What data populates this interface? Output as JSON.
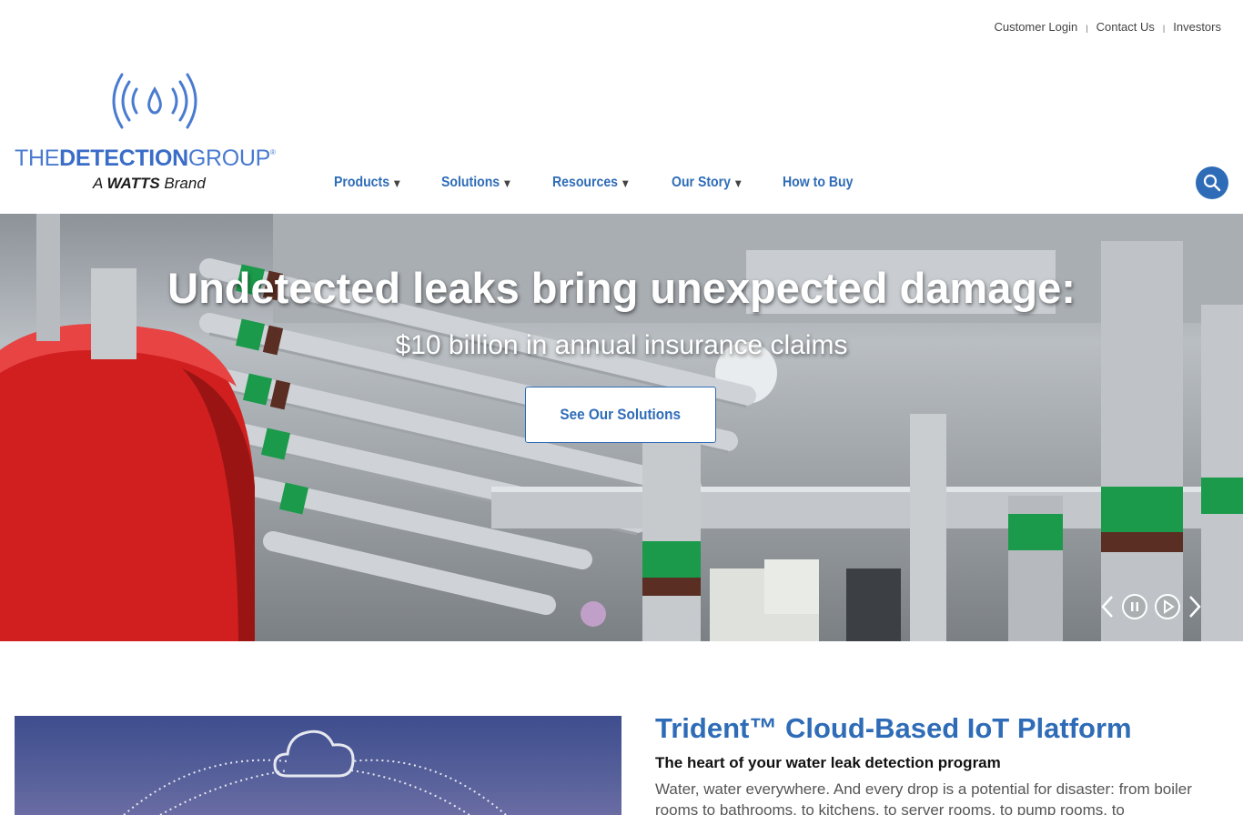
{
  "utility_links": [
    "Customer Login",
    "Contact Us",
    "Investors"
  ],
  "logo": {
    "wordmark_light": "THE",
    "wordmark_bold": "DETECTION",
    "wordmark_end": "GROUP",
    "registered": "®",
    "brand_prefix": "A",
    "brand_name": "WATTS",
    "brand_suffix": "Brand"
  },
  "nav": [
    {
      "label": "Products",
      "has_menu": true
    },
    {
      "label": "Solutions",
      "has_menu": true
    },
    {
      "label": "Resources",
      "has_menu": true
    },
    {
      "label": "Our Story",
      "has_menu": true
    },
    {
      "label": "How to Buy",
      "has_menu": false
    }
  ],
  "nav_caret": "▼",
  "search_icon": "search-icon",
  "hero": {
    "title": "Undetected leaks bring unexpected damage:",
    "subtitle": "$10 billion in annual insurance claims",
    "cta": "See Our Solutions"
  },
  "carousel_icons": [
    "chevron-left-icon",
    "pause-icon",
    "play-icon",
    "chevron-right-icon"
  ],
  "feature": {
    "title": "Trident™ Cloud-Based IoT Platform",
    "subtitle": "The heart of your water leak detection program",
    "body": "Water, water everywhere. And every drop is a potential for disaster: from boiler rooms to bathrooms, to kitchens, to server rooms, to pump rooms, to"
  },
  "colors": {
    "brand_blue": "#2f6cb7",
    "logo_blue": "#4a7bd0",
    "tank_red": "#d11f1f",
    "pipe_green": "#1a9a4a"
  }
}
